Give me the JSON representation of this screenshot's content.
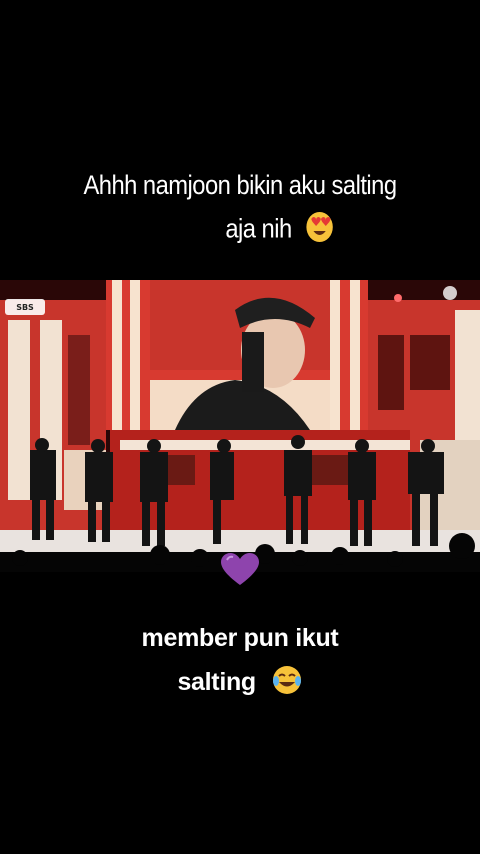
{
  "captions": {
    "top_line_1": "Ahhh namjoon bikin aku salting",
    "top_line_2": "aja nih",
    "bottom_line_1": "member pun ikut",
    "bottom_line_2": "salting"
  },
  "video": {
    "broadcaster_logo": "SBS"
  },
  "icons": {
    "top_emoji": "heart-eyes-emoji",
    "bottom_emoji": "tears-of-joy-emoji",
    "overlay": "purple-heart-emoji"
  },
  "colors": {
    "background": "#000000",
    "caption_text": "#ffffff",
    "stage_red": "#b3261e",
    "purple_heart": "#8e44ad"
  }
}
